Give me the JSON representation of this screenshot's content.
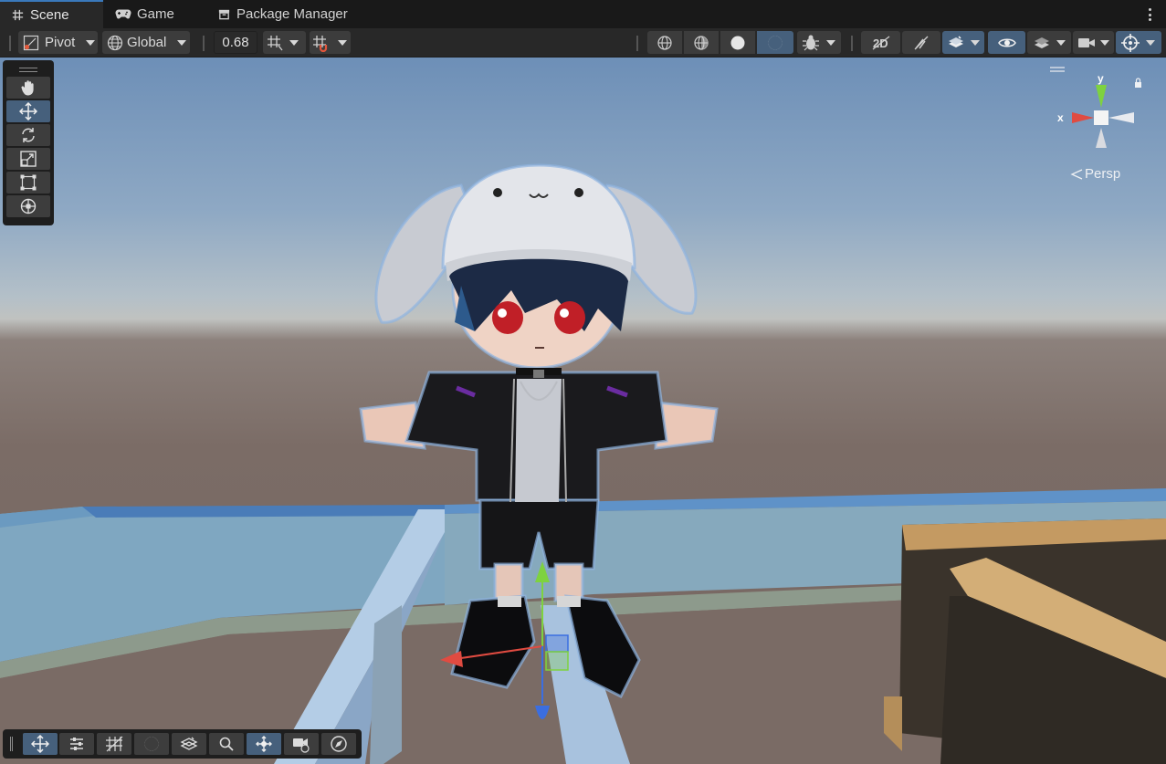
{
  "tabs": [
    {
      "label": "Scene",
      "icon": "hash-icon",
      "active": true
    },
    {
      "label": "Game",
      "icon": "gamepad-icon",
      "active": false
    },
    {
      "label": "Package Manager",
      "icon": "package-icon",
      "active": false
    }
  ],
  "toolbar": {
    "pivot_label": "Pivot",
    "global_label": "Global",
    "grid_size_value": "0.68"
  },
  "gizmo": {
    "y_label": "y",
    "x_label": "x",
    "projection_label": "Persp"
  },
  "colors": {
    "accent": "#46607c",
    "tab_highlight": "#3a79bb",
    "axis_x": "#e04b41",
    "axis_y": "#7ed23f",
    "axis_z": "#3b6ee0"
  }
}
